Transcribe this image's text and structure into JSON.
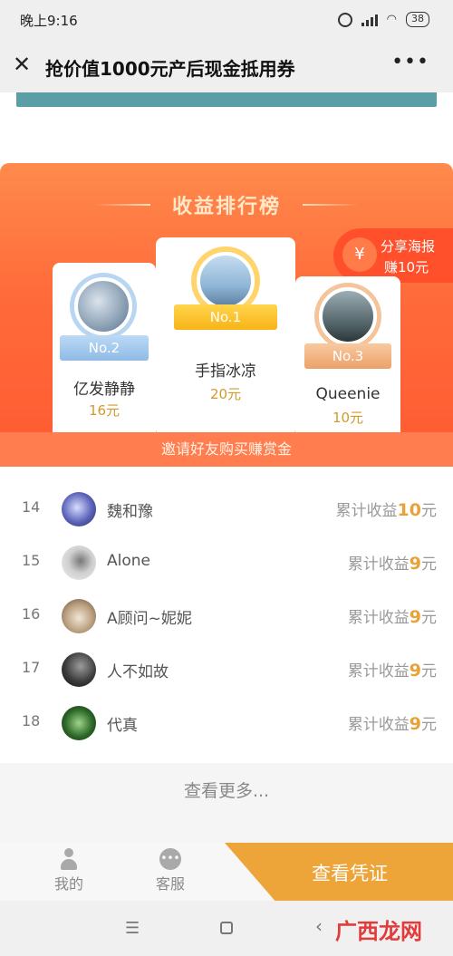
{
  "status_bar": {
    "time": "晚上9:16",
    "battery": "38",
    "wifi_icon": "wifi-icon",
    "alarm_icon": "alarm-icon"
  },
  "nav": {
    "close_icon": "close-icon",
    "title": "抢价值1000元产后现金抵用券",
    "more_icon": "more-icon"
  },
  "leaderboard": {
    "title": "收益排行榜",
    "share": {
      "line1": "分享海报",
      "line2": "赚10元",
      "icon": "money-bag-icon"
    },
    "podium": [
      {
        "rank_label": "No.1",
        "name": "手指冰凉",
        "amount": "20元"
      },
      {
        "rank_label": "No.2",
        "name": "亿发静静",
        "amount": "16元"
      },
      {
        "rank_label": "No.3",
        "name": "Queenie",
        "amount": "10元"
      }
    ],
    "invite_text": "邀请好友购买赚赏金"
  },
  "rank_list": [
    {
      "rank": "14",
      "name": "魏和豫",
      "label": "累计收益",
      "value": "10",
      "unit": "元"
    },
    {
      "rank": "15",
      "name": "Alone",
      "label": "累计收益",
      "value": "9",
      "unit": "元"
    },
    {
      "rank": "16",
      "name": "A顾问~妮妮",
      "label": "累计收益",
      "value": "9",
      "unit": "元"
    },
    {
      "rank": "17",
      "name": "人不如故",
      "label": "累计收益",
      "value": "9",
      "unit": "元"
    },
    {
      "rank": "18",
      "name": "代真",
      "label": "累计收益",
      "value": "9",
      "unit": "元"
    }
  ],
  "more_text": "查看更多...",
  "bottom_bar": {
    "tab_me": "我的",
    "tab_service": "客服",
    "cta": "查看凭证"
  },
  "system_nav": {
    "menu_icon": "☰",
    "back_icon": "‹"
  },
  "watermark": "广西龙网",
  "colors": {
    "accent_orange": "#ff6a3a",
    "gold": "#e8a23a",
    "teal": "#5c9ea6"
  }
}
